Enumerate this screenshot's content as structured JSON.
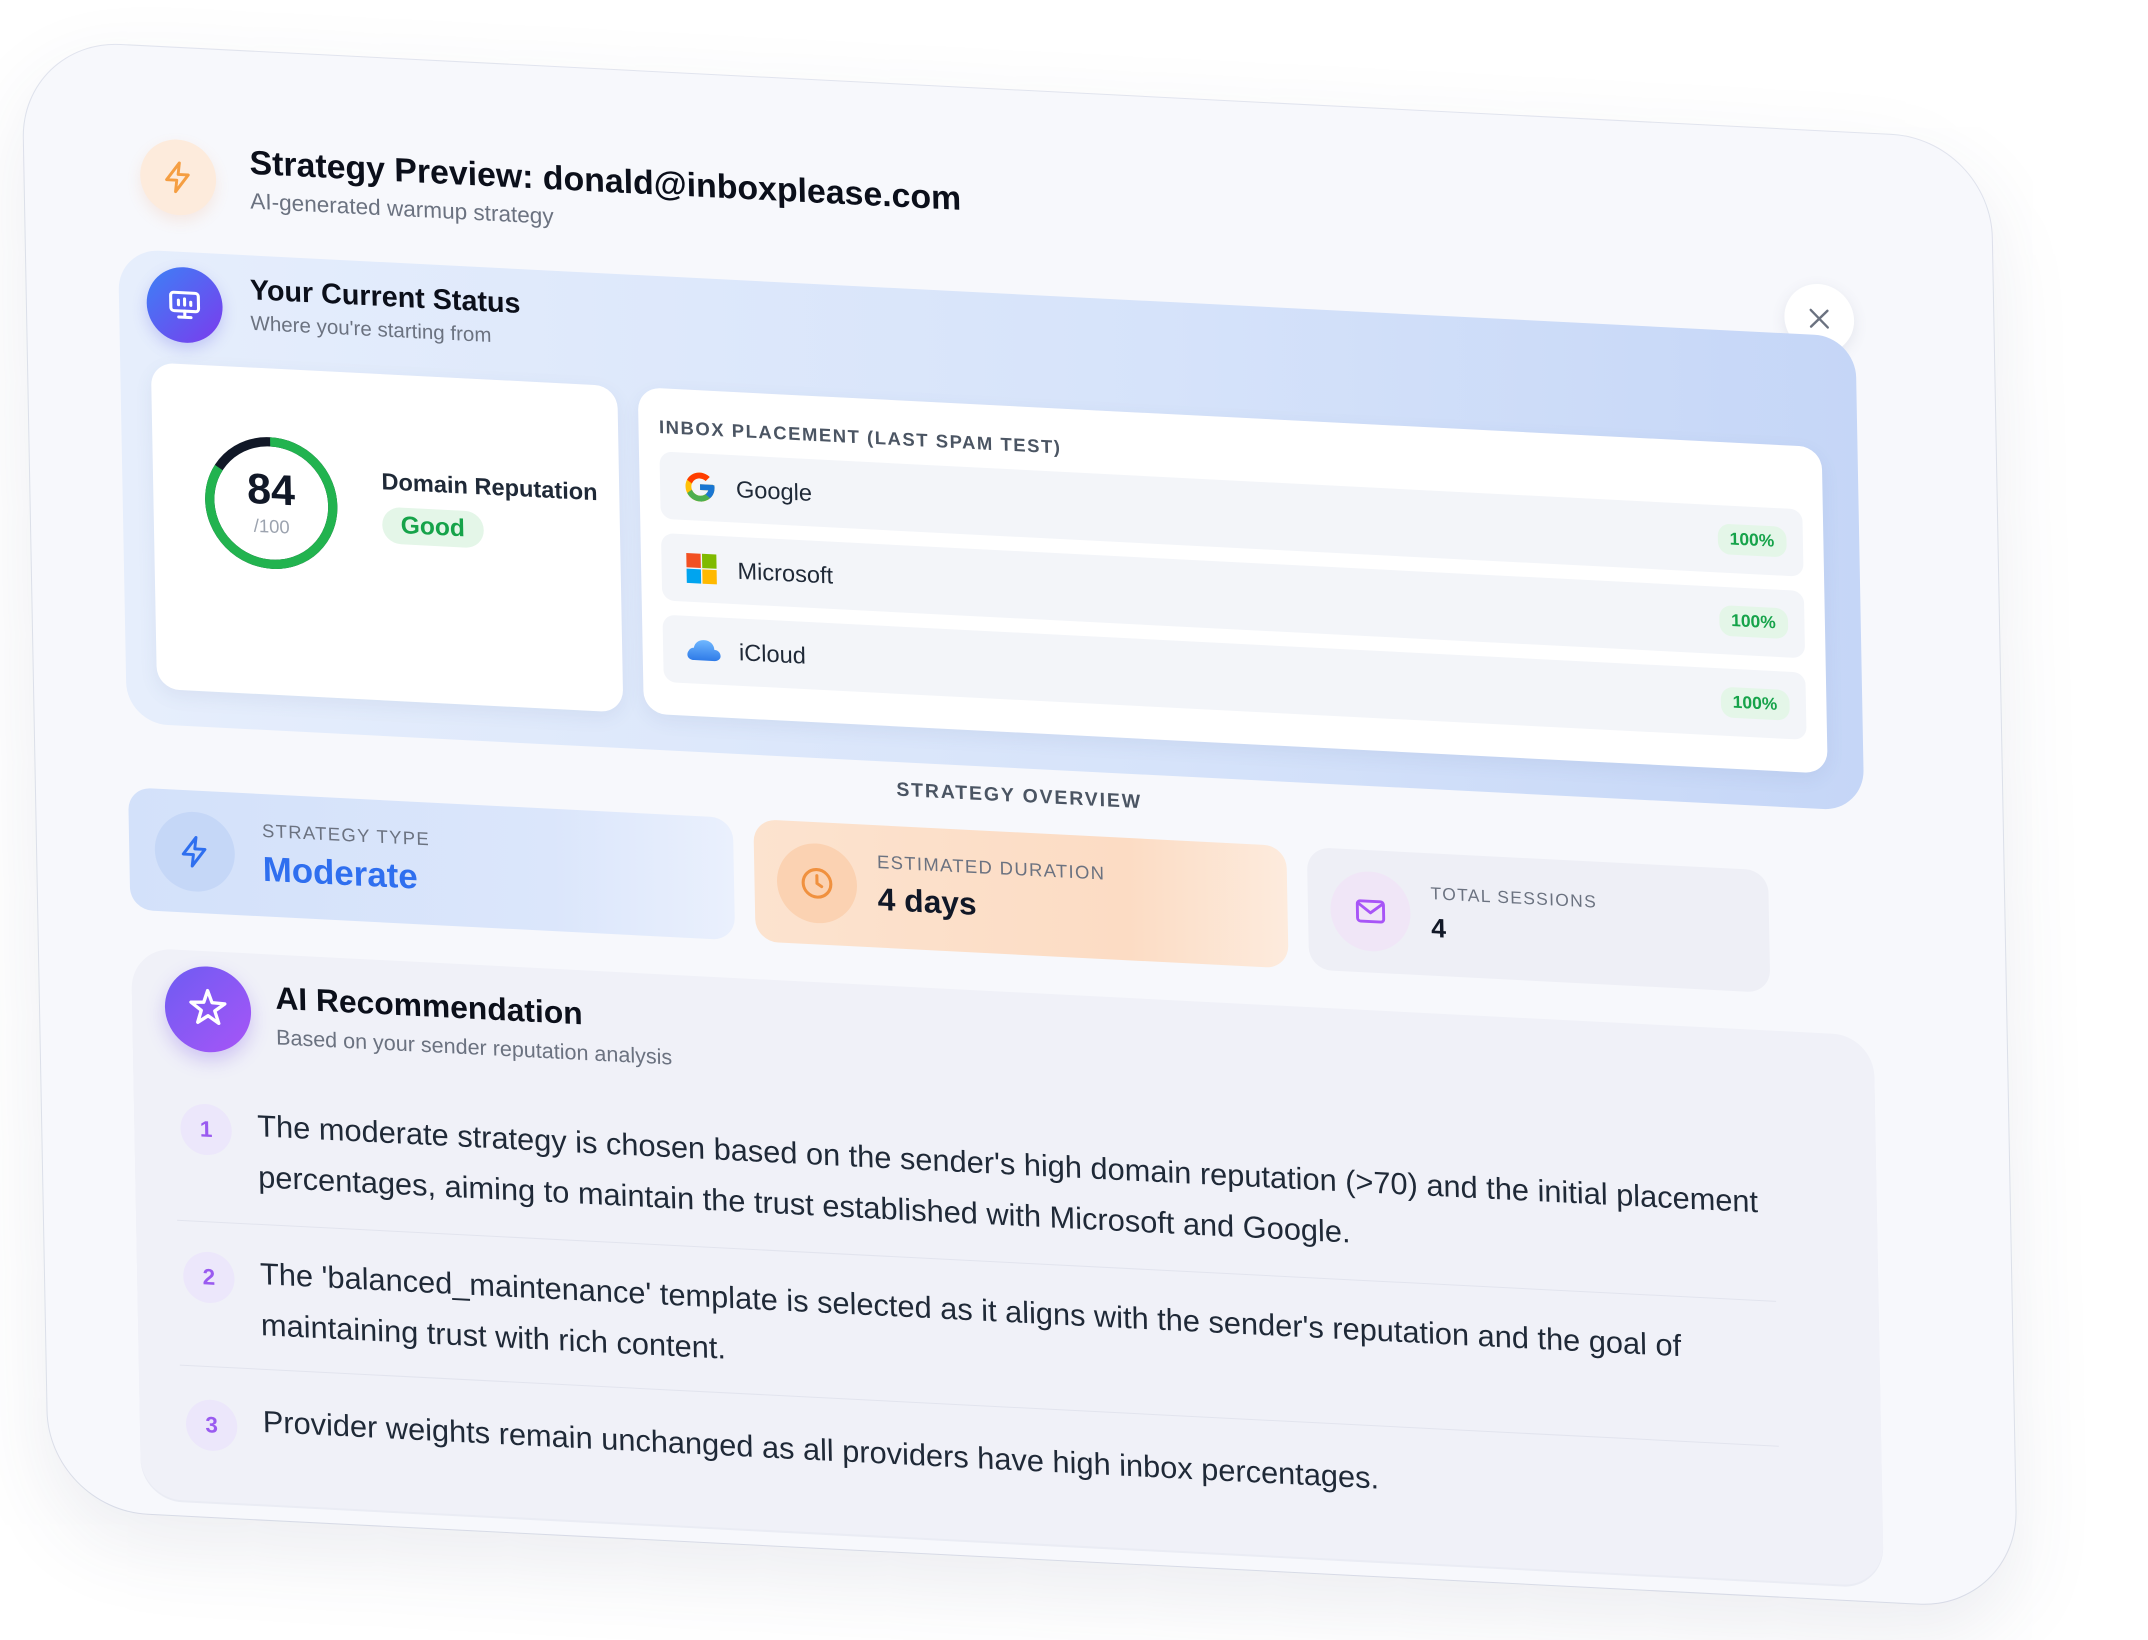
{
  "header": {
    "title": "Strategy Preview: donald@inboxplease.com",
    "subtitle": "AI-generated warmup strategy",
    "icon": "lightning-icon",
    "accent": "#f59e42"
  },
  "status": {
    "title": "Your Current Status",
    "subtitle": "Where you're starting from",
    "reputation": {
      "score": "84",
      "max": "/100",
      "score_fraction": 0.84,
      "label": "Domain Reputation",
      "badge": "Good",
      "color": "#22b34f"
    },
    "placement": {
      "heading": "INBOX PLACEMENT (LAST SPAM TEST)",
      "providers": [
        {
          "name": "Google",
          "percent": "100%",
          "icon": "google-icon"
        },
        {
          "name": "Microsoft",
          "percent": "100%",
          "icon": "microsoft-icon"
        },
        {
          "name": "iCloud",
          "percent": "100%",
          "icon": "icloud-icon"
        }
      ]
    }
  },
  "overview": {
    "heading": "STRATEGY OVERVIEW",
    "type": {
      "label": "STRATEGY TYPE",
      "value": "Moderate",
      "color": "#2f6fef"
    },
    "duration": {
      "label": "ESTIMATED DURATION",
      "value": "4 days",
      "color": "#f0913f"
    },
    "sessions": {
      "label": "TOTAL SESSIONS",
      "value": "4",
      "color": "#a855f7"
    }
  },
  "recommendation": {
    "title": "AI Recommendation",
    "subtitle": "Based on your sender reputation analysis",
    "items": [
      {
        "num": "1",
        "text": "The moderate strategy is chosen based on the sender's high domain reputation (>70) and the initial placement percentages, aiming to maintain the trust established with Microsoft and Google."
      },
      {
        "num": "2",
        "text": "The 'balanced_maintenance' template is selected as it aligns with the sender's reputation and the goal of maintaining trust with rich content."
      },
      {
        "num": "3",
        "text": "Provider weights remain unchanged as all providers have high inbox percentages."
      }
    ]
  }
}
